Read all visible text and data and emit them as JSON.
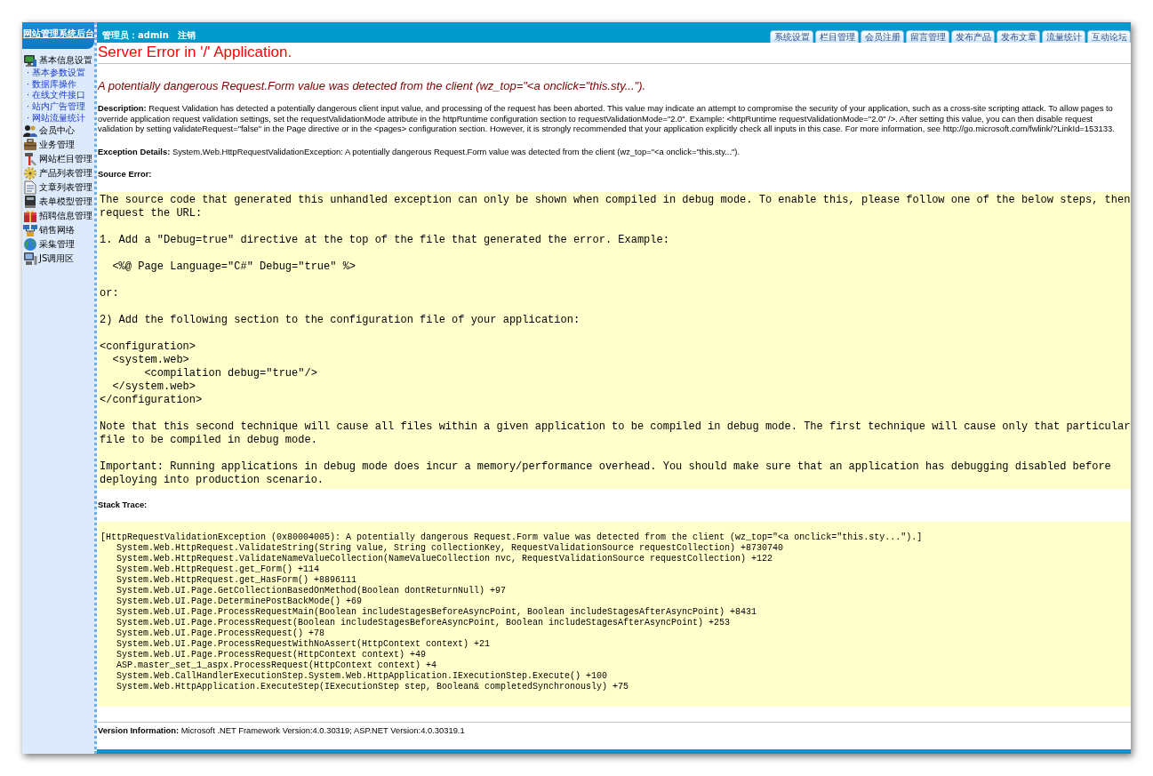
{
  "sidebar": {
    "title": "网站管理系统后台",
    "items": [
      {
        "label": "基本信息设置",
        "children": [
          {
            "label": "· 基本参数设置"
          },
          {
            "label": "· 数据库操作"
          },
          {
            "label": "· 在线文件接口"
          },
          {
            "label": "· 站内广告管理"
          },
          {
            "label": "· 网站流量统计"
          }
        ]
      },
      {
        "label": "会员中心"
      },
      {
        "label": "业务管理"
      },
      {
        "label": "网站栏目管理"
      },
      {
        "label": "产品列表管理"
      },
      {
        "label": "文章列表管理"
      },
      {
        "label": "表单模型管理"
      },
      {
        "label": "招聘信息管理"
      },
      {
        "label": "销售网络"
      },
      {
        "label": "采集管理"
      },
      {
        "label": "JS调用区"
      }
    ]
  },
  "top_bar": {
    "user": "管理员：admin",
    "logout": "注销",
    "tabs": [
      {
        "label": "系统设置"
      },
      {
        "label": "栏目管理"
      },
      {
        "label": "会员注册"
      },
      {
        "label": "留言管理"
      },
      {
        "label": "发布产品"
      },
      {
        "label": "发布文章"
      },
      {
        "label": "流量统计"
      },
      {
        "label": "互动论坛"
      }
    ]
  },
  "error": {
    "title": "Server Error in '/' Application.",
    "message": "A potentially dangerous Request.Form value was detected from the client (wz_top=\"<a onclick=\"this.sty...\").",
    "description": "**Description:** Request Validation has detected a potentially dangerous client input value, and processing of the request has been aborted. This value may indicate an attempt to compromise the security of your application, such as a cross-site scripting attack. To allow pages to override application request validation settings, set the requestValidationMode attribute in the httpRuntime configuration section to requestValidationMode=\"2.0\". Example: <httpRuntime requestValidationMode=\"2.0\" />. After setting this value, you can then disable request validation by setting validateRequest=\"false\" in the Page directive or in the <pages> configuration section. However, it is strongly recommended that your application explicitly check all inputs in this case. For more information, see http://go.microsoft.com/fwlink/?LinkId=153133.",
    "exception_details": "**Exception Details:** System.Web.HttpRequestValidationException: A potentially dangerous Request.Form value was detected from the client (wz_top=\"<a onclick=\"this.sty...\").",
    "source_error": {
      "label": "Source Error:",
      "paragraphs": [
        "The source code that generated this unhandled exception can only be shown when compiled in debug mode. To enable this, please follow one of the below steps, then request the URL:",
        "1. Add a \"Debug=true\" directive at the top of the file that generated the error. Example:",
        "  <%@ Page Language=\"C#\" Debug=\"true\" %>",
        "or:",
        "2) Add the following section to the configuration file of your application:",
        "<configuration>\n  <system.web>\n       <compilation debug=\"true\"/>\n  </system.web>\n</configuration>",
        "Note that this second technique will cause all files within a given application to be compiled in debug mode. The first technique will cause only that particular file to be compiled in debug mode.",
        "Important: Running applications in debug mode does incur a memory/performance overhead. You should make sure that an application has debugging disabled before deploying into production scenario."
      ]
    },
    "stack_trace": {
      "label": "Stack Trace:",
      "exception": "[HttpRequestValidationException (0x80004005): A potentially dangerous Request.Form value was detected from the client (wz_top=\"<a onclick=\"this.sty...\").]",
      "frames": [
        "System.Web.HttpRequest.ValidateString(String value, String collectionKey, RequestValidationSource requestCollection) +8730740",
        "System.Web.HttpRequest.ValidateNameValueCollection(NameValueCollection nvc, RequestValidationSource requestCollection) +122",
        "System.Web.HttpRequest.get_Form() +114",
        "System.Web.HttpRequest.get_HasForm() +8896111",
        "System.Web.UI.Page.GetCollectionBasedOnMethod(Boolean dontReturnNull) +97",
        "System.Web.UI.Page.DeterminePostBackMode() +69",
        "System.Web.UI.Page.ProcessRequestMain(Boolean includeStagesBeforeAsyncPoint, Boolean includeStagesAfterAsyncPoint) +8431",
        "System.Web.UI.Page.ProcessRequest(Boolean includeStagesBeforeAsyncPoint, Boolean includeStagesAfterAsyncPoint) +253",
        "System.Web.UI.Page.ProcessRequest() +78",
        "System.Web.UI.Page.ProcessRequestWithNoAssert(HttpContext context) +21",
        "System.Web.UI.Page.ProcessRequest(HttpContext context) +49",
        "ASP.master_set_1_aspx.ProcessRequest(HttpContext context) +4",
        "System.Web.CallHandlerExecutionStep.System.Web.HttpApplication.IExecutionStep.Execute() +100",
        "System.Web.HttpApplication.ExecuteStep(IExecutionStep step, Boolean& completedSynchronously) +75"
      ]
    },
    "version": "**Version Information:** Microsoft .NET Framework Version:4.0.30319; ASP.NET Version:4.0.30319.1"
  }
}
